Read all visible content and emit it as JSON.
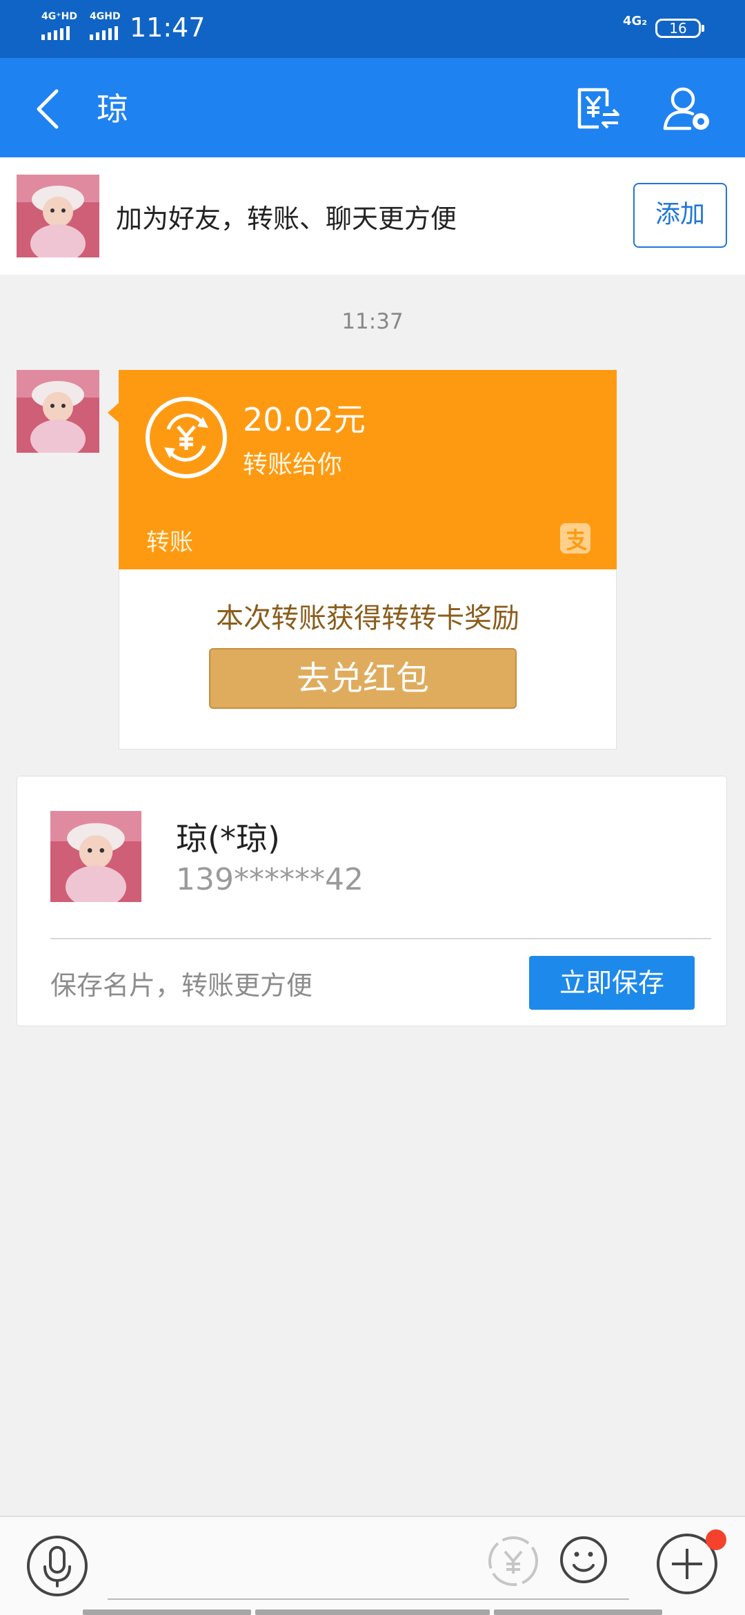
{
  "status_bar": {
    "network_1": "4G⁺HD",
    "network_2": "4GHD",
    "time": "11:47",
    "network_right": "4G₂",
    "battery": "16"
  },
  "nav": {
    "title": "琼",
    "back_icon": "back-chevron-icon",
    "transfer_icon": "yuan-transfer-icon",
    "settings_icon": "contact-settings-icon"
  },
  "friend_banner": {
    "text": "加为好友，转账、聊天更方便",
    "add_label": "添加"
  },
  "chat": {
    "timestamp": "11:37",
    "transfer": {
      "amount": "20.02元",
      "subtitle": "转账给你",
      "label": "转账",
      "reward_text": "本次转账获得转转卡奖励",
      "redeem_label": "去兑红包",
      "accent": "#fe9a12"
    },
    "contact_card": {
      "name": "琼(*琼)",
      "phone": "139******42",
      "save_hint": "保存名片，转账更方便",
      "save_label": "立即保存"
    }
  },
  "input_bar": {
    "icons": [
      "microphone-icon",
      "yuan-icon",
      "emoji-icon",
      "plus-icon"
    ]
  },
  "colors": {
    "status_bar": "#1064c5",
    "nav_bar": "#1f82f1",
    "primary_button": "#1d89ea",
    "notification_dot": "#f4422c"
  }
}
